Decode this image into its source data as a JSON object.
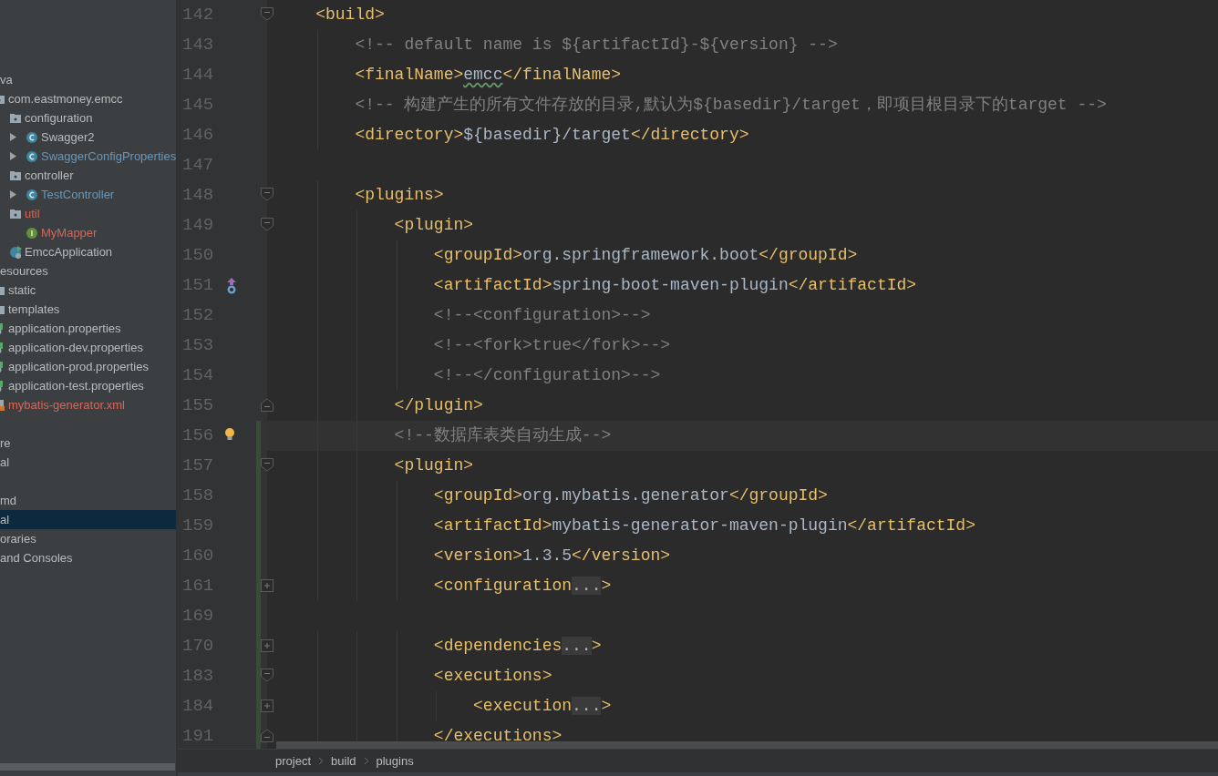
{
  "project_tree": {
    "groups": [
      [
        {
          "text": "va",
          "selected": false,
          "children": [
            {
              "text": "com.eastmoney.emcc",
              "kind": "package",
              "selected": false,
              "children": [
                {
                  "text": "configuration",
                  "kind": "package",
                  "selected": false,
                  "children": [
                    {
                      "text": "Swagger2",
                      "kind": "class",
                      "expanded": false,
                      "selected": false
                    },
                    {
                      "text": "SwaggerConfigProperties",
                      "kind": "class",
                      "expanded": false,
                      "color": "#6897bb",
                      "selected": false
                    }
                  ]
                },
                {
                  "text": "controller",
                  "kind": "package",
                  "selected": false,
                  "children": [
                    {
                      "text": "TestController",
                      "kind": "class",
                      "expanded": false,
                      "color": "#6897bb",
                      "selected": false
                    }
                  ]
                },
                {
                  "text": "util",
                  "kind": "package",
                  "color": "#d1675a",
                  "selected": false,
                  "children": [
                    {
                      "text": "MyMapper",
                      "kind": "interface",
                      "color": "#d1675a",
                      "selected": false
                    }
                  ]
                },
                {
                  "text": "EmccApplication",
                  "kind": "application",
                  "selected": false
                }
              ]
            }
          ]
        },
        {
          "text": "esources",
          "selected": false,
          "children": [
            {
              "text": "static",
              "kind": "folder",
              "selected": false
            },
            {
              "text": "templates",
              "kind": "folder",
              "selected": false
            },
            {
              "text": "application.properties",
              "kind": "properties",
              "selected": false
            },
            {
              "text": "application-dev.properties",
              "kind": "properties",
              "selected": false
            },
            {
              "text": "application-prod.properties",
              "kind": "properties",
              "selected": false
            },
            {
              "text": "application-test.properties",
              "kind": "properties",
              "selected": false
            },
            {
              "text": "mybatis-generator.xml",
              "kind": "xml",
              "color": "#d1675a",
              "selected": false
            }
          ]
        }
      ],
      [
        {
          "text": "re",
          "selected": false
        },
        {
          "text": "al",
          "selected": false
        }
      ],
      [
        {
          "text": "md",
          "selected": false
        },
        {
          "text": "al",
          "selected": true
        },
        {
          "text": "oraries",
          "selected": false
        },
        {
          "text": "and Consoles",
          "selected": false
        }
      ]
    ]
  },
  "editor": {
    "lines": [
      {
        "number": "142",
        "fold_marker": {
          "kind": "start"
        },
        "changed": false,
        "current": false,
        "tokens": [
          {
            "kind": "tag",
            "text": "    <build>"
          }
        ]
      },
      {
        "number": "143",
        "changed": false,
        "current": false,
        "tokens": [
          {
            "kind": "comment",
            "text": "        <!-- default name is ${artifactId}-${version} -->"
          }
        ]
      },
      {
        "number": "144",
        "changed": false,
        "current": false,
        "tokens": [
          {
            "kind": "tag",
            "text": "        <finalName>"
          },
          {
            "kind": "misspelled",
            "text": "emcc"
          },
          {
            "kind": "tag",
            "text": "</finalName>"
          }
        ]
      },
      {
        "number": "145",
        "changed": false,
        "current": false,
        "tokens": [
          {
            "kind": "comment",
            "text": "        <!-- 构建产生的所有文件存放的目录,默认为${basedir}/target，即项目根目录下的target -->"
          }
        ]
      },
      {
        "number": "146",
        "changed": false,
        "current": false,
        "tokens": [
          {
            "kind": "tag",
            "text": "        <directory>"
          },
          {
            "kind": "text",
            "text": "${basedir}/target"
          },
          {
            "kind": "tag",
            "text": "</directory>"
          }
        ]
      },
      {
        "number": "147",
        "changed": false,
        "current": false
      },
      {
        "number": "148",
        "fold_marker": {
          "kind": "start"
        },
        "changed": false,
        "current": false,
        "tokens": [
          {
            "kind": "tag",
            "text": "        <plugins>"
          }
        ]
      },
      {
        "number": "149",
        "fold_marker": {
          "kind": "start"
        },
        "changed": false,
        "current": false,
        "tokens": [
          {
            "kind": "tag",
            "text": "            <plugin>"
          }
        ]
      },
      {
        "number": "150",
        "changed": false,
        "current": false,
        "tokens": [
          {
            "kind": "tag",
            "text": "                <groupId>"
          },
          {
            "kind": "text",
            "text": "org.springframework.boot"
          },
          {
            "kind": "tag",
            "text": "</groupId>"
          }
        ]
      },
      {
        "number": "151",
        "gutter_icon": {
          "kind": "run"
        },
        "changed": false,
        "current": false,
        "tokens": [
          {
            "kind": "tag",
            "text": "                <artifactId>"
          },
          {
            "kind": "text",
            "text": "spring-boot-maven-plugin"
          },
          {
            "kind": "tag",
            "text": "</artifactId>"
          }
        ]
      },
      {
        "number": "152",
        "changed": false,
        "current": false,
        "tokens": [
          {
            "kind": "comment",
            "text": "                <!--<configuration>-->"
          }
        ]
      },
      {
        "number": "153",
        "changed": false,
        "current": false,
        "tokens": [
          {
            "kind": "comment",
            "text": "                <!--<fork>true</fork>-->"
          }
        ]
      },
      {
        "number": "154",
        "changed": false,
        "current": false,
        "tokens": [
          {
            "kind": "comment",
            "text": "                <!--</configuration>-->"
          }
        ]
      },
      {
        "number": "155",
        "fold_marker": {
          "kind": "end"
        },
        "changed": false,
        "current": false,
        "tokens": [
          {
            "kind": "tag",
            "text": "            </plugin>"
          }
        ]
      },
      {
        "number": "156",
        "gutter_icon": {
          "kind": "hint"
        },
        "changed": true,
        "current": true,
        "tokens": [
          {
            "kind": "comment",
            "text": "            <!--数据库表类自动生成-->"
          }
        ]
      },
      {
        "number": "157",
        "fold_marker": {
          "kind": "start"
        },
        "changed": true,
        "current": false,
        "tokens": [
          {
            "kind": "tag",
            "text": "            <plugin>"
          }
        ]
      },
      {
        "number": "158",
        "changed": true,
        "current": false,
        "tokens": [
          {
            "kind": "tag",
            "text": "                <groupId>"
          },
          {
            "kind": "text",
            "text": "org.mybatis.generator"
          },
          {
            "kind": "tag",
            "text": "</groupId>"
          }
        ]
      },
      {
        "number": "159",
        "changed": true,
        "current": false,
        "tokens": [
          {
            "kind": "tag",
            "text": "                <artifactId>"
          },
          {
            "kind": "text",
            "text": "mybatis-generator-maven-plugin"
          },
          {
            "kind": "tag",
            "text": "</artifactId>"
          }
        ]
      },
      {
        "number": "160",
        "changed": true,
        "current": false,
        "tokens": [
          {
            "kind": "tag",
            "text": "                <version>"
          },
          {
            "kind": "text",
            "text": "1.3.5"
          },
          {
            "kind": "tag",
            "text": "</version>"
          }
        ]
      },
      {
        "number": "161",
        "fold_marker": {
          "kind": "collapsed"
        },
        "changed": true,
        "current": false,
        "tokens": [
          {
            "kind": "tag",
            "text": "                <configuration"
          },
          {
            "kind": "folded",
            "text": "..."
          },
          {
            "kind": "tag",
            "text": ">"
          }
        ]
      },
      {
        "number": "169",
        "changed": true,
        "current": false
      },
      {
        "number": "170",
        "fold_marker": {
          "kind": "collapsed"
        },
        "changed": true,
        "current": false,
        "tokens": [
          {
            "kind": "tag",
            "text": "                <dependencies"
          },
          {
            "kind": "folded",
            "text": "..."
          },
          {
            "kind": "tag",
            "text": ">"
          }
        ]
      },
      {
        "number": "183",
        "fold_marker": {
          "kind": "start"
        },
        "changed": true,
        "current": false,
        "tokens": [
          {
            "kind": "tag",
            "text": "                <executions>"
          }
        ]
      },
      {
        "number": "184",
        "fold_marker": {
          "kind": "collapsed"
        },
        "changed": true,
        "current": false,
        "tokens": [
          {
            "kind": "tag",
            "text": "                    <execution"
          },
          {
            "kind": "folded",
            "text": "..."
          },
          {
            "kind": "tag",
            "text": ">"
          }
        ]
      },
      {
        "number": "191",
        "fold_marker": {
          "kind": "end"
        },
        "changed": true,
        "current": false,
        "tokens": [
          {
            "kind": "tag",
            "text": "                </executions>"
          }
        ]
      }
    ]
  },
  "breadcrumbs": [
    "project",
    "build",
    "plugins"
  ]
}
